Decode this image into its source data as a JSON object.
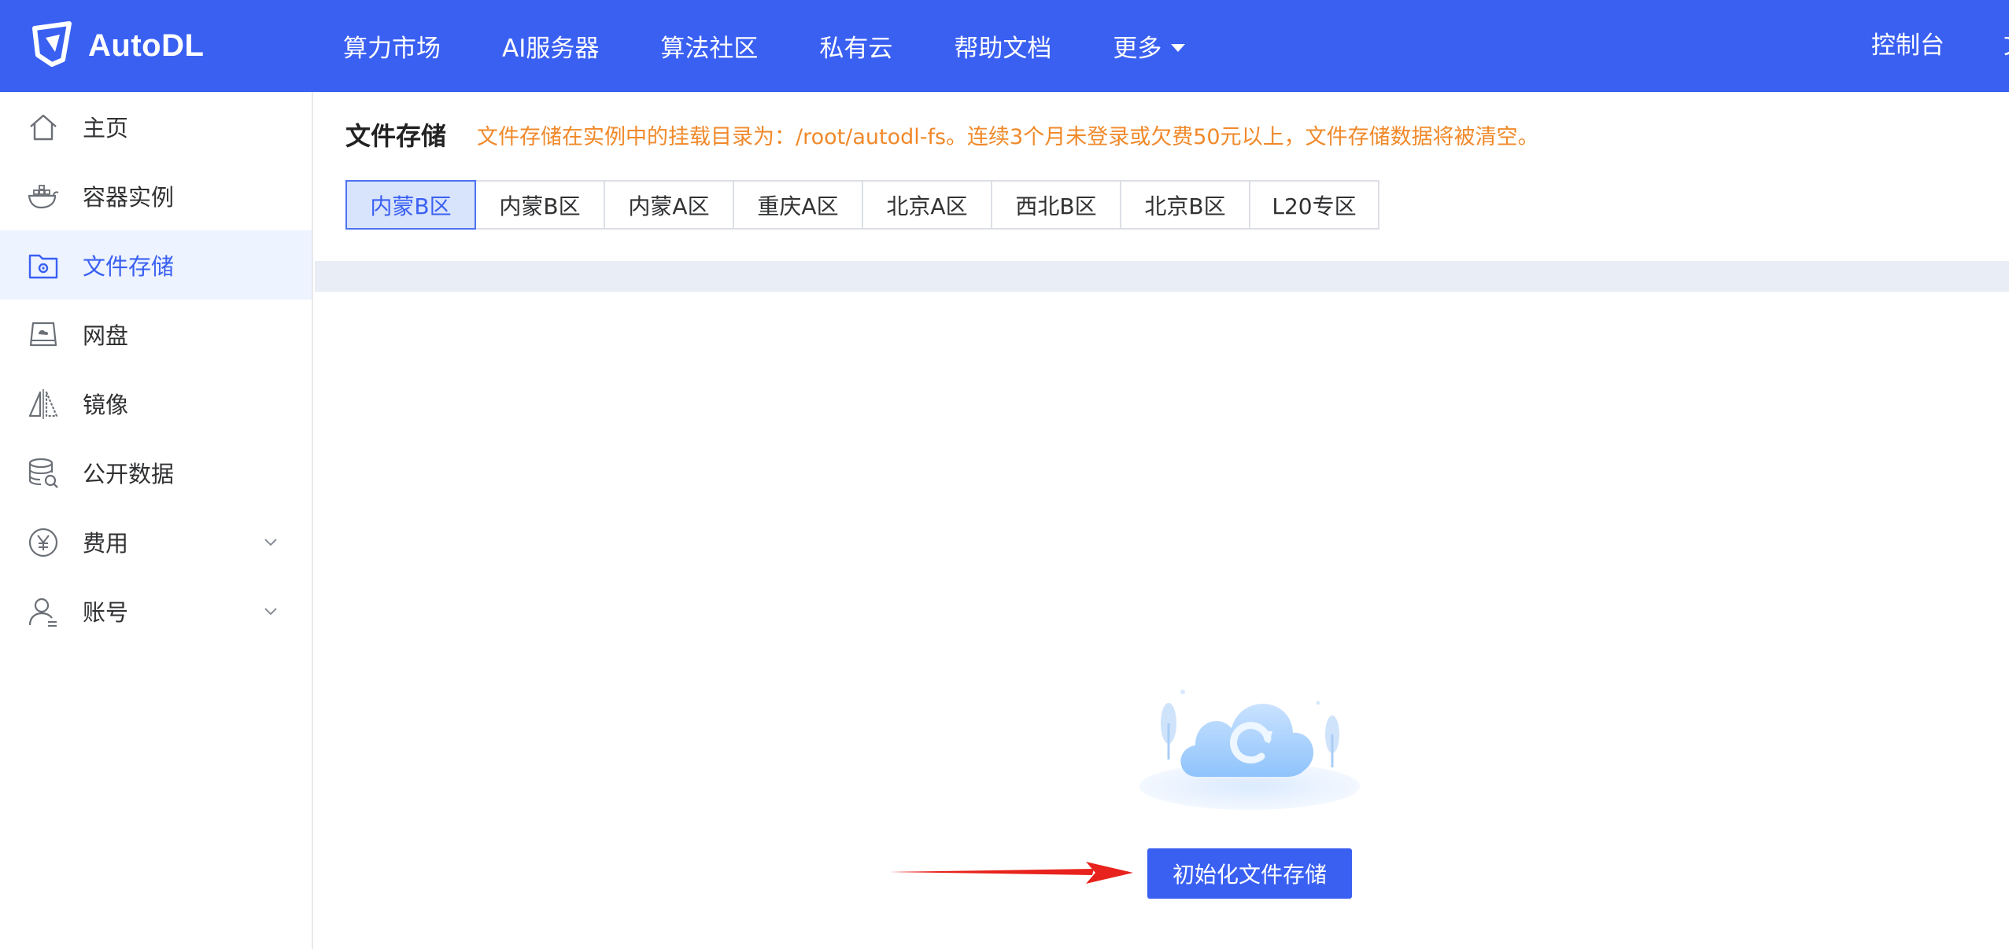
{
  "header": {
    "logo_text": "AutoDL",
    "nav_items": [
      "算力市场",
      "AI服务器",
      "算法社区",
      "私有云",
      "帮助文档",
      "更多"
    ],
    "console_label": "控制台",
    "edge_glyph": "文",
    "brand_color": "#3a60f2"
  },
  "sidebar": {
    "items": [
      {
        "label": "主页",
        "icon": "home-icon"
      },
      {
        "label": "容器实例",
        "icon": "docker-whale-icon"
      },
      {
        "label": "文件存储",
        "icon": "folder-gear-icon",
        "active": true
      },
      {
        "label": "网盘",
        "icon": "disk-cloud-icon"
      },
      {
        "label": "镜像",
        "icon": "mirror-icon"
      },
      {
        "label": "公开数据",
        "icon": "database-search-icon"
      },
      {
        "label": "费用",
        "icon": "yen-circle-icon",
        "expandable": true
      },
      {
        "label": "账号",
        "icon": "user-icon",
        "expandable": true
      }
    ]
  },
  "main": {
    "title": "文件存储",
    "notice": "文件存储在实例中的挂载目录为：/root/autodl-fs。连续3个月未登录或欠费50元以上，文件存储数据将被清空。",
    "notice_color": "#f0892a",
    "region_tabs": [
      "内蒙B区",
      "内蒙B区",
      "内蒙A区",
      "重庆A区",
      "北京A区",
      "西北B区",
      "北京B区",
      "L20专区"
    ],
    "active_tab_index": 0,
    "empty_state_icon": "cloud-refresh-icon",
    "init_button_label": "初始化文件存储"
  }
}
